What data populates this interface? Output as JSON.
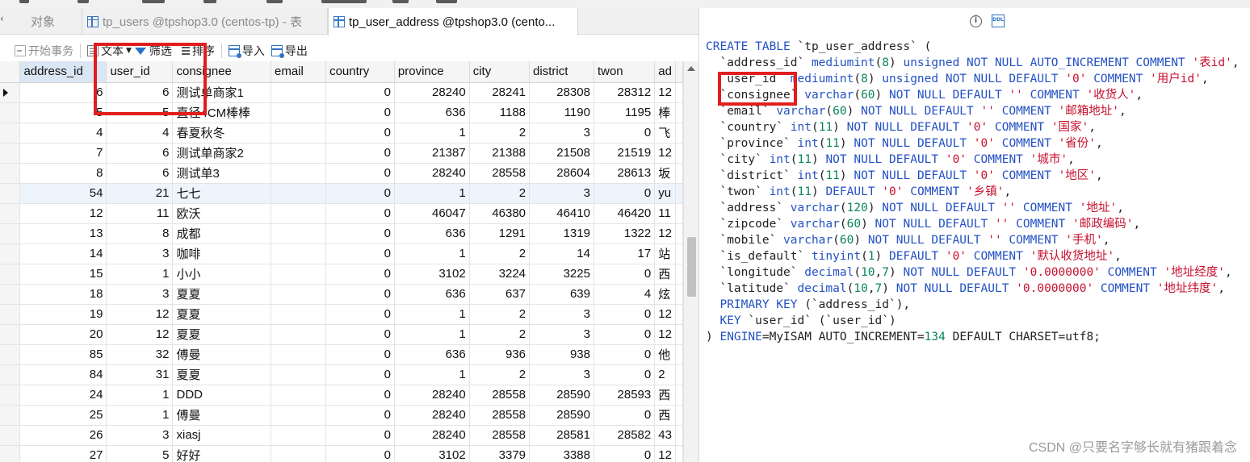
{
  "tabs": [
    {
      "label": "对象",
      "icon": "none"
    },
    {
      "label": "tp_users @tpshop3.0 (centos-tp) - 表",
      "icon": "table-icon"
    },
    {
      "label": "tp_user_address @tpshop3.0 (cento...",
      "icon": "table-icon"
    }
  ],
  "toolbar": {
    "begin_tx": "开始事务",
    "text": "文本",
    "filter": "筛选",
    "sort": "排序",
    "import": "导入",
    "export": "导出"
  },
  "grid": {
    "columns": [
      "address_id",
      "user_id",
      "consignee",
      "email",
      "country",
      "province",
      "city",
      "district",
      "twon",
      "ad"
    ],
    "rows": [
      [
        "6",
        "6",
        "测试单商家1",
        "",
        "0",
        "28240",
        "28241",
        "28308",
        "28312",
        "12"
      ],
      [
        "5",
        "5",
        "直径4CM棒棒",
        "",
        "0",
        "636",
        "1188",
        "1190",
        "1195",
        "棒"
      ],
      [
        "4",
        "4",
        "春夏秋冬",
        "",
        "0",
        "1",
        "2",
        "3",
        "0",
        "飞"
      ],
      [
        "7",
        "6",
        "测试单商家2",
        "",
        "0",
        "21387",
        "21388",
        "21508",
        "21519",
        "12"
      ],
      [
        "8",
        "6",
        "测试单3",
        "",
        "0",
        "28240",
        "28558",
        "28604",
        "28613",
        "坂"
      ],
      [
        "54",
        "21",
        "七七",
        "",
        "0",
        "1",
        "2",
        "3",
        "0",
        "yu"
      ],
      [
        "12",
        "11",
        "欧沃",
        "",
        "0",
        "46047",
        "46380",
        "46410",
        "46420",
        "11"
      ],
      [
        "13",
        "8",
        "成都",
        "",
        "0",
        "636",
        "1291",
        "1319",
        "1322",
        "12"
      ],
      [
        "14",
        "3",
        "咖啡",
        "",
        "0",
        "1",
        "2",
        "14",
        "17",
        "站"
      ],
      [
        "15",
        "1",
        "小小",
        "",
        "0",
        "3102",
        "3224",
        "3225",
        "0",
        "西"
      ],
      [
        "18",
        "3",
        "夏夏",
        "",
        "0",
        "636",
        "637",
        "639",
        "4",
        "炫"
      ],
      [
        "19",
        "12",
        "夏夏",
        "",
        "0",
        "1",
        "2",
        "3",
        "0",
        "12"
      ],
      [
        "20",
        "12",
        "夏夏",
        "",
        "0",
        "1",
        "2",
        "3",
        "0",
        "12"
      ],
      [
        "85",
        "32",
        "傅曼",
        "",
        "0",
        "636",
        "936",
        "938",
        "0",
        "他"
      ],
      [
        "84",
        "31",
        "夏夏",
        "",
        "0",
        "1",
        "2",
        "3",
        "0",
        "2"
      ],
      [
        "24",
        "1",
        "DDD",
        "",
        "0",
        "28240",
        "28558",
        "28590",
        "28593",
        "西"
      ],
      [
        "25",
        "1",
        "傅曼",
        "",
        "0",
        "28240",
        "28558",
        "28590",
        "0",
        "西"
      ],
      [
        "26",
        "3",
        "xiasj",
        "",
        "0",
        "28240",
        "28558",
        "28581",
        "28582",
        "43"
      ],
      [
        "27",
        "5",
        "好好",
        "",
        "0",
        "3102",
        "3379",
        "3388",
        "0",
        "12"
      ]
    ]
  },
  "ddl": {
    "lines": [
      [
        {
          "t": "CREATE TABLE ",
          "c": "k"
        },
        {
          "t": "`tp_user_address` (",
          "c": "p"
        }
      ],
      [
        {
          "t": "  `address_id` ",
          "c": "p"
        },
        {
          "t": "mediumint",
          "c": "k"
        },
        {
          "t": "(",
          "c": "p"
        },
        {
          "t": "8",
          "c": "n"
        },
        {
          "t": ") ",
          "c": "p"
        },
        {
          "t": "unsigned NOT NULL AUTO_INCREMENT COMMENT ",
          "c": "k"
        },
        {
          "t": "'表id'",
          "c": "s"
        },
        {
          "t": ",",
          "c": "p"
        }
      ],
      [
        {
          "t": "  `user_id` ",
          "c": "p"
        },
        {
          "t": "mediumint",
          "c": "k"
        },
        {
          "t": "(",
          "c": "p"
        },
        {
          "t": "8",
          "c": "n"
        },
        {
          "t": ") ",
          "c": "p"
        },
        {
          "t": "unsigned NOT NULL DEFAULT ",
          "c": "k"
        },
        {
          "t": "'0'",
          "c": "s"
        },
        {
          "t": " COMMENT ",
          "c": "k"
        },
        {
          "t": "'用户id'",
          "c": "s"
        },
        {
          "t": ",",
          "c": "p"
        }
      ],
      [
        {
          "t": "  `consignee` ",
          "c": "p"
        },
        {
          "t": "varchar",
          "c": "k"
        },
        {
          "t": "(",
          "c": "p"
        },
        {
          "t": "60",
          "c": "n"
        },
        {
          "t": ") ",
          "c": "p"
        },
        {
          "t": "NOT NULL DEFAULT ",
          "c": "k"
        },
        {
          "t": "''",
          "c": "s"
        },
        {
          "t": " COMMENT ",
          "c": "k"
        },
        {
          "t": "'收货人'",
          "c": "s"
        },
        {
          "t": ",",
          "c": "p"
        }
      ],
      [
        {
          "t": "  `email` ",
          "c": "p"
        },
        {
          "t": "varchar",
          "c": "k"
        },
        {
          "t": "(",
          "c": "p"
        },
        {
          "t": "60",
          "c": "n"
        },
        {
          "t": ") ",
          "c": "p"
        },
        {
          "t": "NOT NULL DEFAULT ",
          "c": "k"
        },
        {
          "t": "''",
          "c": "s"
        },
        {
          "t": " COMMENT ",
          "c": "k"
        },
        {
          "t": "'邮箱地址'",
          "c": "s"
        },
        {
          "t": ",",
          "c": "p"
        }
      ],
      [
        {
          "t": "  `country` ",
          "c": "p"
        },
        {
          "t": "int",
          "c": "k"
        },
        {
          "t": "(",
          "c": "p"
        },
        {
          "t": "11",
          "c": "n"
        },
        {
          "t": ") ",
          "c": "p"
        },
        {
          "t": "NOT NULL DEFAULT ",
          "c": "k"
        },
        {
          "t": "'0'",
          "c": "s"
        },
        {
          "t": " COMMENT ",
          "c": "k"
        },
        {
          "t": "'国家'",
          "c": "s"
        },
        {
          "t": ",",
          "c": "p"
        }
      ],
      [
        {
          "t": "  `province` ",
          "c": "p"
        },
        {
          "t": "int",
          "c": "k"
        },
        {
          "t": "(",
          "c": "p"
        },
        {
          "t": "11",
          "c": "n"
        },
        {
          "t": ") ",
          "c": "p"
        },
        {
          "t": "NOT NULL DEFAULT ",
          "c": "k"
        },
        {
          "t": "'0'",
          "c": "s"
        },
        {
          "t": " COMMENT ",
          "c": "k"
        },
        {
          "t": "'省份'",
          "c": "s"
        },
        {
          "t": ",",
          "c": "p"
        }
      ],
      [
        {
          "t": "  `city` ",
          "c": "p"
        },
        {
          "t": "int",
          "c": "k"
        },
        {
          "t": "(",
          "c": "p"
        },
        {
          "t": "11",
          "c": "n"
        },
        {
          "t": ") ",
          "c": "p"
        },
        {
          "t": "NOT NULL DEFAULT ",
          "c": "k"
        },
        {
          "t": "'0'",
          "c": "s"
        },
        {
          "t": " COMMENT ",
          "c": "k"
        },
        {
          "t": "'城市'",
          "c": "s"
        },
        {
          "t": ",",
          "c": "p"
        }
      ],
      [
        {
          "t": "  `district` ",
          "c": "p"
        },
        {
          "t": "int",
          "c": "k"
        },
        {
          "t": "(",
          "c": "p"
        },
        {
          "t": "11",
          "c": "n"
        },
        {
          "t": ") ",
          "c": "p"
        },
        {
          "t": "NOT NULL DEFAULT ",
          "c": "k"
        },
        {
          "t": "'0'",
          "c": "s"
        },
        {
          "t": " COMMENT ",
          "c": "k"
        },
        {
          "t": "'地区'",
          "c": "s"
        },
        {
          "t": ",",
          "c": "p"
        }
      ],
      [
        {
          "t": "  `twon` ",
          "c": "p"
        },
        {
          "t": "int",
          "c": "k"
        },
        {
          "t": "(",
          "c": "p"
        },
        {
          "t": "11",
          "c": "n"
        },
        {
          "t": ") ",
          "c": "p"
        },
        {
          "t": "DEFAULT ",
          "c": "k"
        },
        {
          "t": "'0'",
          "c": "s"
        },
        {
          "t": " COMMENT ",
          "c": "k"
        },
        {
          "t": "'乡镇'",
          "c": "s"
        },
        {
          "t": ",",
          "c": "p"
        }
      ],
      [
        {
          "t": "  `address` ",
          "c": "p"
        },
        {
          "t": "varchar",
          "c": "k"
        },
        {
          "t": "(",
          "c": "p"
        },
        {
          "t": "120",
          "c": "n"
        },
        {
          "t": ") ",
          "c": "p"
        },
        {
          "t": "NOT NULL DEFAULT ",
          "c": "k"
        },
        {
          "t": "''",
          "c": "s"
        },
        {
          "t": " COMMENT ",
          "c": "k"
        },
        {
          "t": "'地址'",
          "c": "s"
        },
        {
          "t": ",",
          "c": "p"
        }
      ],
      [
        {
          "t": "  `zipcode` ",
          "c": "p"
        },
        {
          "t": "varchar",
          "c": "k"
        },
        {
          "t": "(",
          "c": "p"
        },
        {
          "t": "60",
          "c": "n"
        },
        {
          "t": ") ",
          "c": "p"
        },
        {
          "t": "NOT NULL DEFAULT ",
          "c": "k"
        },
        {
          "t": "''",
          "c": "s"
        },
        {
          "t": " COMMENT ",
          "c": "k"
        },
        {
          "t": "'邮政编码'",
          "c": "s"
        },
        {
          "t": ",",
          "c": "p"
        }
      ],
      [
        {
          "t": "  `mobile` ",
          "c": "p"
        },
        {
          "t": "varchar",
          "c": "k"
        },
        {
          "t": "(",
          "c": "p"
        },
        {
          "t": "60",
          "c": "n"
        },
        {
          "t": ") ",
          "c": "p"
        },
        {
          "t": "NOT NULL DEFAULT ",
          "c": "k"
        },
        {
          "t": "''",
          "c": "s"
        },
        {
          "t": " COMMENT ",
          "c": "k"
        },
        {
          "t": "'手机'",
          "c": "s"
        },
        {
          "t": ",",
          "c": "p"
        }
      ],
      [
        {
          "t": "  `is_default` ",
          "c": "p"
        },
        {
          "t": "tinyint",
          "c": "k"
        },
        {
          "t": "(",
          "c": "p"
        },
        {
          "t": "1",
          "c": "n"
        },
        {
          "t": ") ",
          "c": "p"
        },
        {
          "t": "DEFAULT ",
          "c": "k"
        },
        {
          "t": "'0'",
          "c": "s"
        },
        {
          "t": " COMMENT ",
          "c": "k"
        },
        {
          "t": "'默认收货地址'",
          "c": "s"
        },
        {
          "t": ",",
          "c": "p"
        }
      ],
      [
        {
          "t": "  `longitude` ",
          "c": "p"
        },
        {
          "t": "decimal",
          "c": "k"
        },
        {
          "t": "(",
          "c": "p"
        },
        {
          "t": "10",
          "c": "n"
        },
        {
          "t": ",",
          "c": "p"
        },
        {
          "t": "7",
          "c": "n"
        },
        {
          "t": ") ",
          "c": "p"
        },
        {
          "t": "NOT NULL DEFAULT ",
          "c": "k"
        },
        {
          "t": "'0.0000000'",
          "c": "s"
        },
        {
          "t": " COMMENT ",
          "c": "k"
        },
        {
          "t": "'地址经度'",
          "c": "s"
        },
        {
          "t": ",",
          "c": "p"
        }
      ],
      [
        {
          "t": "  `latitude` ",
          "c": "p"
        },
        {
          "t": "decimal",
          "c": "k"
        },
        {
          "t": "(",
          "c": "p"
        },
        {
          "t": "10",
          "c": "n"
        },
        {
          "t": ",",
          "c": "p"
        },
        {
          "t": "7",
          "c": "n"
        },
        {
          "t": ") ",
          "c": "p"
        },
        {
          "t": "NOT NULL DEFAULT ",
          "c": "k"
        },
        {
          "t": "'0.0000000'",
          "c": "s"
        },
        {
          "t": " COMMENT ",
          "c": "k"
        },
        {
          "t": "'地址纬度'",
          "c": "s"
        },
        {
          "t": ",",
          "c": "p"
        }
      ],
      [
        {
          "t": "  PRIMARY KEY ",
          "c": "k"
        },
        {
          "t": "(`address_id`),",
          "c": "p"
        }
      ],
      [
        {
          "t": "  KEY ",
          "c": "k"
        },
        {
          "t": "`user_id` (`user_id`)",
          "c": "p"
        }
      ],
      [
        {
          "t": ") ",
          "c": "p"
        },
        {
          "t": "ENGINE",
          "c": "k"
        },
        {
          "t": "=MyISAM AUTO_INCREMENT=",
          "c": "p"
        },
        {
          "t": "134",
          "c": "n"
        },
        {
          "t": " DEFAULT CHARSET=utf8;",
          "c": "p"
        }
      ]
    ]
  },
  "watermark": "CSDN @只要名字够长就有猪跟着念",
  "colors": {
    "highlight_box": "#e21d1d",
    "keyword": "#2351c4",
    "string": "#c8102e",
    "number": "#098658"
  }
}
